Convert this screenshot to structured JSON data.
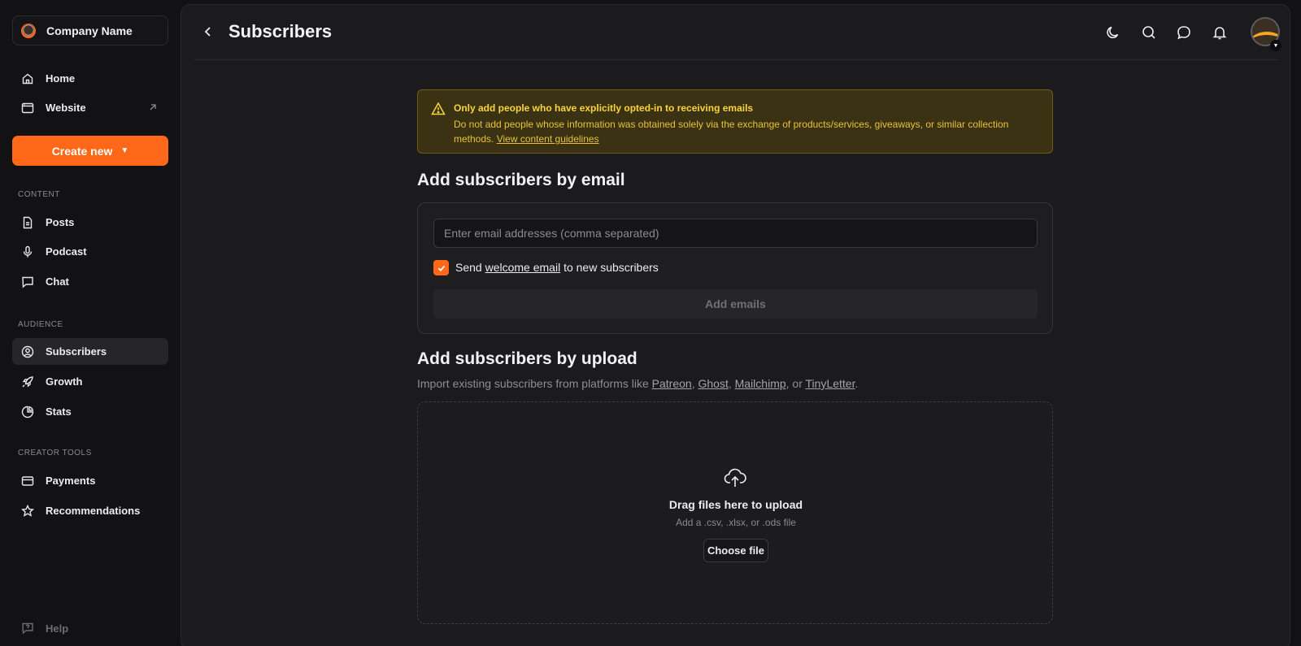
{
  "sidebar": {
    "company_name": "Company Name",
    "nav_top": [
      {
        "label": "Home",
        "icon": "home-icon"
      },
      {
        "label": "Website",
        "icon": "browser-window-icon"
      }
    ],
    "create_label": "Create new",
    "sections": [
      {
        "title": "CONTENT",
        "items": [
          {
            "label": "Posts",
            "icon": "document-icon"
          },
          {
            "label": "Podcast",
            "icon": "microphone-icon"
          },
          {
            "label": "Chat",
            "icon": "chat-bubble-icon"
          }
        ]
      },
      {
        "title": "AUDIENCE",
        "items": [
          {
            "label": "Subscribers",
            "icon": "user-circle-icon",
            "active": true
          },
          {
            "label": "Growth",
            "icon": "rocket-icon"
          },
          {
            "label": "Stats",
            "icon": "pie-chart-icon"
          }
        ]
      },
      {
        "title": "CREATOR TOOLS",
        "items": [
          {
            "label": "Payments",
            "icon": "credit-card-icon"
          },
          {
            "label": "Recommendations",
            "icon": "star-icon"
          }
        ]
      }
    ],
    "help_label": "Help"
  },
  "header": {
    "title": "Subscribers",
    "icons": [
      "moon-icon",
      "search-icon",
      "message-icon",
      "bell-icon"
    ]
  },
  "alert": {
    "title": "Only add people who have explicitly opted-in to receiving emails",
    "body": "Do not add people whose information was obtained solely via the exchange of products/services, giveaways, or similar collection methods.",
    "link": "View content guidelines"
  },
  "email_section": {
    "heading": "Add subscribers by email",
    "input_placeholder": "Enter email addresses (comma separated)",
    "input_value": "",
    "checkbox_checked": true,
    "checkbox_prefix": "Send",
    "checkbox_link": "welcome email",
    "checkbox_suffix": "to new subscribers",
    "button_label": "Add emails"
  },
  "upload_section": {
    "heading": "Add subscribers by upload",
    "desc_prefix": "Import existing subscribers from platforms like",
    "platforms": [
      "Patreon",
      "Ghost",
      "Mailchimp",
      "TinyLetter"
    ],
    "dropzone_title": "Drag files here to upload",
    "dropzone_sub": "Add a .csv, .xlsx, or .ods file",
    "choose_label": "Choose file"
  },
  "colors": {
    "accent": "#ff6719",
    "alert_text": "#f8d53c",
    "alert_bg": "#3a3212"
  }
}
